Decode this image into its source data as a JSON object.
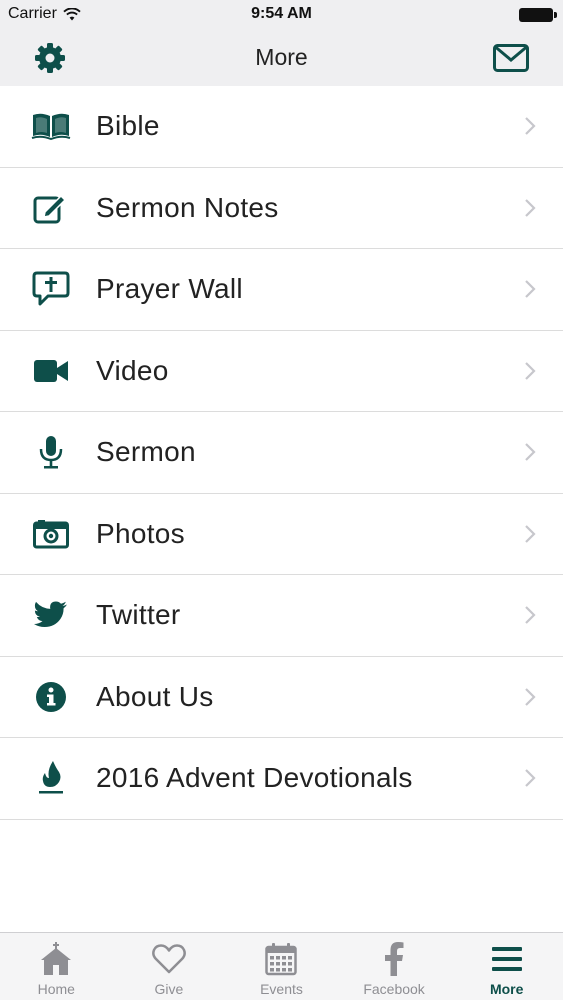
{
  "status_bar": {
    "carrier": "Carrier",
    "time": "9:54 AM"
  },
  "nav": {
    "title": "More",
    "left_icon": "gear-icon",
    "right_icon": "envelope-icon"
  },
  "colors": {
    "accent": "#0e4f4a",
    "chevron": "#c7c7cc",
    "tab_inactive": "#8e8e93"
  },
  "menu": {
    "items": [
      {
        "label": "Bible",
        "icon": "book-icon"
      },
      {
        "label": "Sermon Notes",
        "icon": "edit-icon"
      },
      {
        "label": " Prayer Wall",
        "icon": "prayer-bubble-icon"
      },
      {
        "label": "Video",
        "icon": "video-camera-icon"
      },
      {
        "label": "Sermon",
        "icon": "microphone-icon"
      },
      {
        "label": "Photos",
        "icon": "camera-icon"
      },
      {
        "label": "Twitter",
        "icon": "twitter-icon"
      },
      {
        "label": "About Us",
        "icon": "info-icon"
      },
      {
        "label": "2016 Advent Devotionals",
        "icon": "flame-icon"
      }
    ]
  },
  "tabs": [
    {
      "label": "Home",
      "icon": "church-icon",
      "active": false
    },
    {
      "label": "Give",
      "icon": "heart-icon",
      "active": false
    },
    {
      "label": "Events",
      "icon": "calendar-icon",
      "active": false
    },
    {
      "label": "Facebook",
      "icon": "facebook-icon",
      "active": false
    },
    {
      "label": "More",
      "icon": "hamburger-icon",
      "active": true
    }
  ]
}
